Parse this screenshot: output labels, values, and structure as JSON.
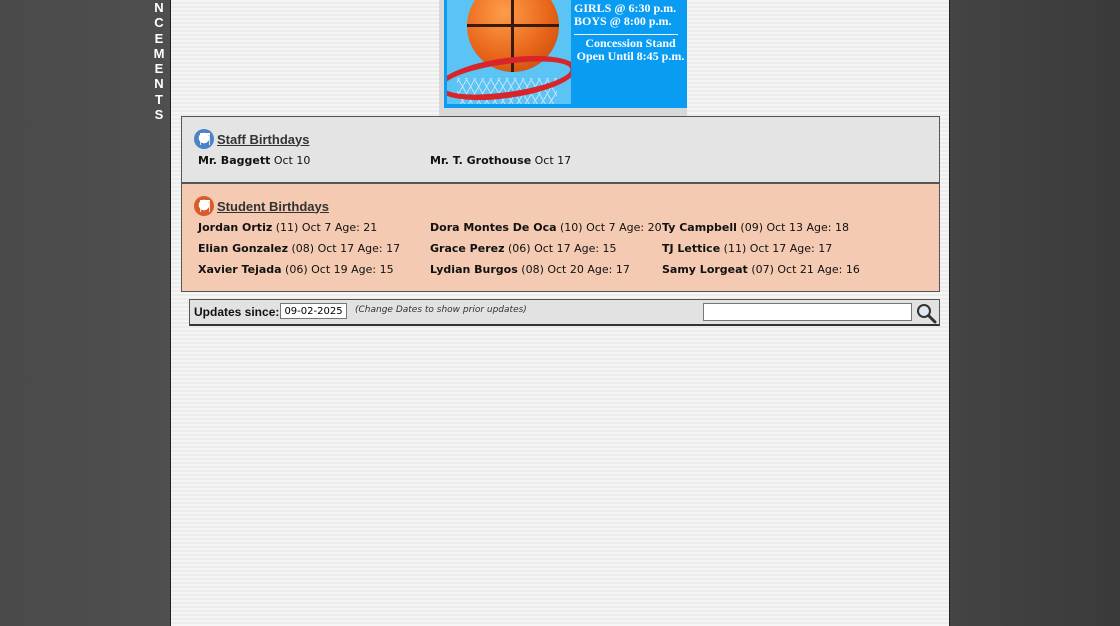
{
  "sidebar_word": [
    "N",
    "C",
    "E",
    "M",
    "E",
    "N",
    "T",
    "S"
  ],
  "banner": {
    "line1": "GIRLS @ 6:30 p.m.",
    "line2": "BOYS  @ 8:00 p.m.",
    "line3": "Concession Stand",
    "line4": "Open Until 8:45 p.m."
  },
  "staff_birthdays": {
    "title": "Staff Birthdays",
    "entries": [
      {
        "name": "Mr. Baggett",
        "detail": " Oct 10"
      },
      {
        "name": "Mr. T. Grothouse",
        "detail": " Oct 17"
      }
    ]
  },
  "student_birthdays": {
    "title": " Student Birthdays",
    "entries": [
      {
        "name": "Jordan Ortiz",
        "detail": " (11) Oct 7 Age: 21"
      },
      {
        "name": "Dora Montes De Oca",
        "detail": " (10) Oct 7 Age: 20"
      },
      {
        "name": "Ty Campbell",
        "detail": " (09) Oct 13 Age: 18"
      },
      {
        "name": "Elian Gonzalez",
        "detail": " (08) Oct 17 Age: 17"
      },
      {
        "name": "Grace Perez",
        "detail": " (06) Oct 17 Age: 15"
      },
      {
        "name": "TJ Lettice",
        "detail": " (11) Oct 17 Age: 17"
      },
      {
        "name": "Xavier Tejada",
        "detail": " (06) Oct 19 Age: 15"
      },
      {
        "name": "Lydian Burgos",
        "detail": " (08) Oct 20 Age: 17"
      },
      {
        "name": "Samy Lorgeat",
        "detail": " (07) Oct 21 Age: 16"
      }
    ]
  },
  "updates": {
    "label": "Updates since:",
    "date_value": "09-02-2025",
    "hint": "(Change Dates to show prior updates)",
    "search_value": ""
  },
  "colors": {
    "banner_bg": "#0a9cf2",
    "staff_bg": "#e4e4e4",
    "student_bg": "#f4cbb2"
  }
}
